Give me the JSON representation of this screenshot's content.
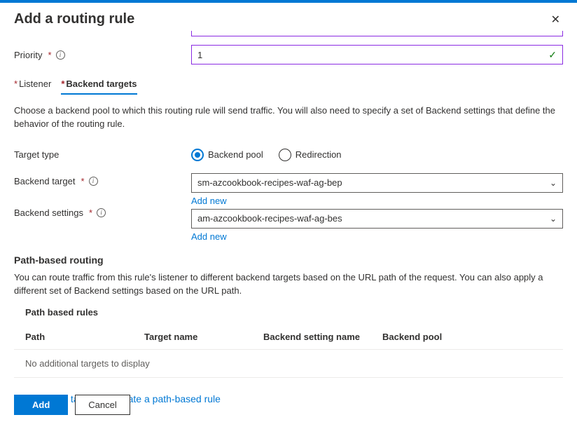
{
  "header": {
    "title": "Add a routing rule"
  },
  "priority": {
    "label": "Priority",
    "value": "1"
  },
  "tabs": {
    "listener": "Listener",
    "backend": "Backend targets"
  },
  "descriptions": {
    "backend_intro": "Choose a backend pool to which this routing rule will send traffic. You will also need to specify a set of Backend settings that define the behavior of the routing rule.",
    "path_routing": "You can route traffic from this rule's listener to different backend targets based on the URL path of the request. You can also apply a different set of Backend settings based on the URL path."
  },
  "target_type": {
    "label": "Target type",
    "options": {
      "pool": "Backend pool",
      "redirection": "Redirection"
    }
  },
  "backend_target": {
    "label": "Backend target",
    "value": "sm-azcookbook-recipes-waf-ag-bep",
    "add_new": "Add new"
  },
  "backend_settings": {
    "label": "Backend settings",
    "value": "am-azcookbook-recipes-waf-ag-bes",
    "add_new": "Add new"
  },
  "sections": {
    "path_based": "Path-based routing",
    "path_rules": "Path based rules"
  },
  "table": {
    "headers": {
      "path": "Path",
      "target": "Target name",
      "setting": "Backend setting name",
      "pool": "Backend pool"
    },
    "empty": "No additional targets to display"
  },
  "links": {
    "add_multiple": "Add multiple targets to create a path-based rule"
  },
  "buttons": {
    "add": "Add",
    "cancel": "Cancel"
  }
}
